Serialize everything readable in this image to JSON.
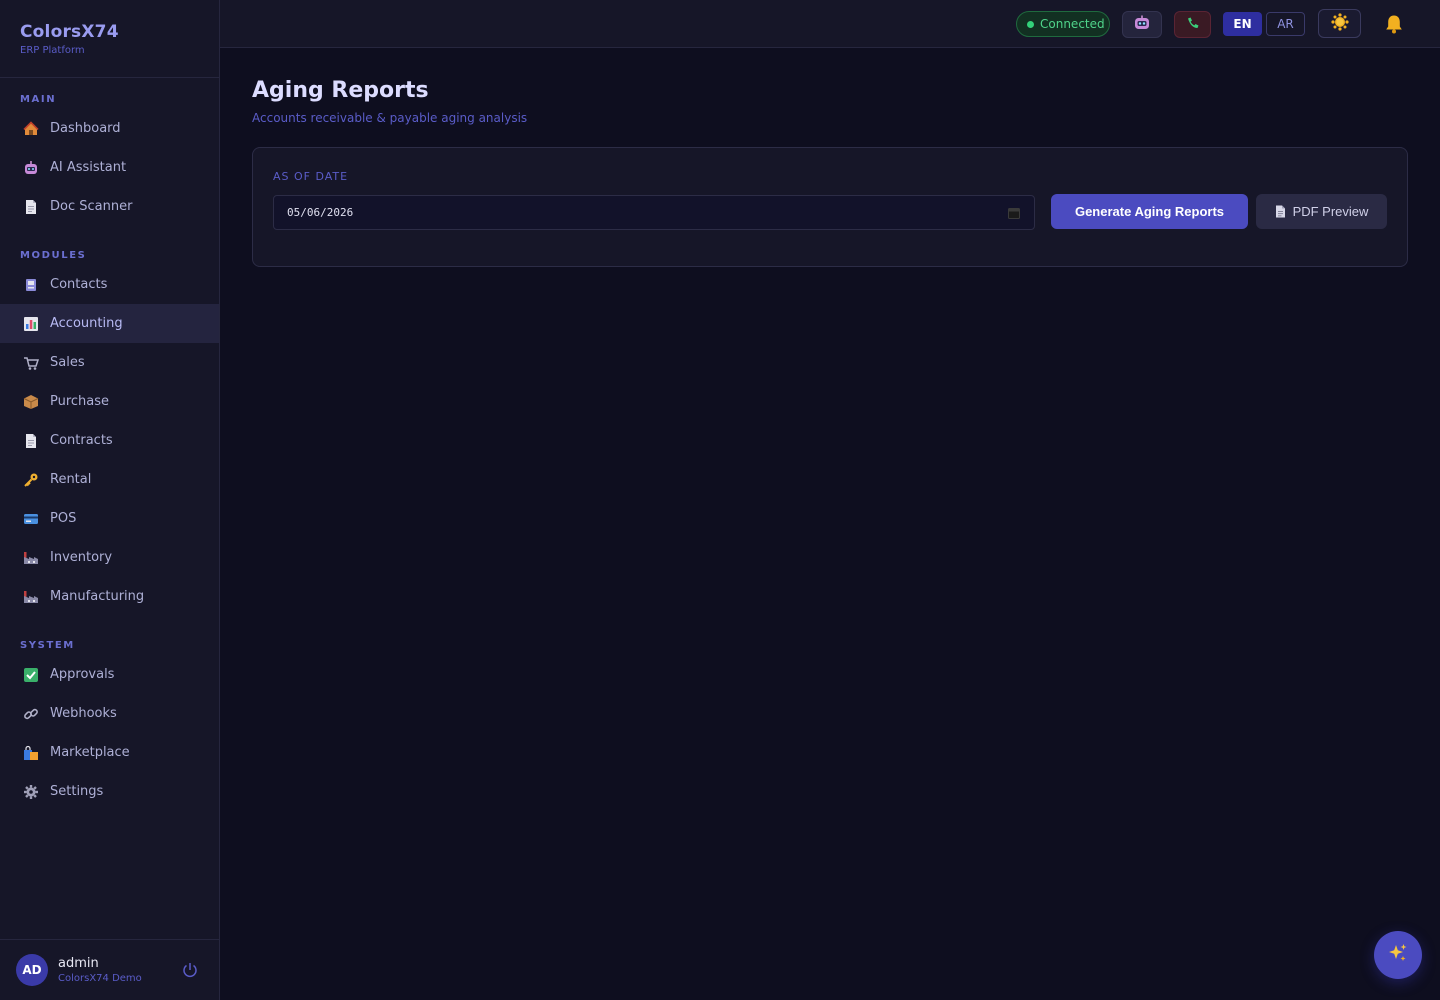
{
  "brand": {
    "title": "ColorsX74",
    "subtitle": "ERP Platform"
  },
  "sidebar": {
    "sections": [
      {
        "label": "MAIN",
        "items": [
          {
            "label": "Dashboard",
            "icon": "house-icon"
          },
          {
            "label": "AI Assistant",
            "icon": "robot-icon"
          },
          {
            "label": "Doc Scanner",
            "icon": "document-icon"
          }
        ]
      },
      {
        "label": "MODULES",
        "items": [
          {
            "label": "Contacts",
            "icon": "contacts-icon"
          },
          {
            "label": "Accounting",
            "icon": "bar-chart-icon",
            "active": true
          },
          {
            "label": "Sales",
            "icon": "cash-register-icon"
          },
          {
            "label": "Purchase",
            "icon": "package-icon"
          },
          {
            "label": "Contracts",
            "icon": "document-icon"
          },
          {
            "label": "Rental",
            "icon": "key-icon"
          },
          {
            "label": "POS",
            "icon": "credit-card-icon"
          },
          {
            "label": "Inventory",
            "icon": "factory-icon"
          },
          {
            "label": "Manufacturing",
            "icon": "factory-icon"
          }
        ]
      },
      {
        "label": "SYSTEM",
        "items": [
          {
            "label": "Approvals",
            "icon": "check-icon"
          },
          {
            "label": "Webhooks",
            "icon": "link-icon"
          },
          {
            "label": "Marketplace",
            "icon": "shopping-bags-icon"
          },
          {
            "label": "Settings",
            "icon": "gear-icon"
          }
        ]
      }
    ]
  },
  "user": {
    "initials": "AD",
    "name": "admin",
    "org": "ColorsX74 Demo"
  },
  "topbar": {
    "status": "Connected",
    "lang_en": "EN",
    "lang_ar": "AR"
  },
  "page": {
    "title": "Aging Reports",
    "subtitle": "Accounts receivable & payable aging analysis"
  },
  "form": {
    "date_label": "AS OF DATE",
    "date_value": "05/06/2026",
    "generate_label": "Generate Aging Reports",
    "pdf_label": "PDF Preview"
  },
  "colors": {
    "accent": "#4b4bc0",
    "background": "#0e0e1f",
    "sidebar": "#161628",
    "success": "#33d17a"
  }
}
